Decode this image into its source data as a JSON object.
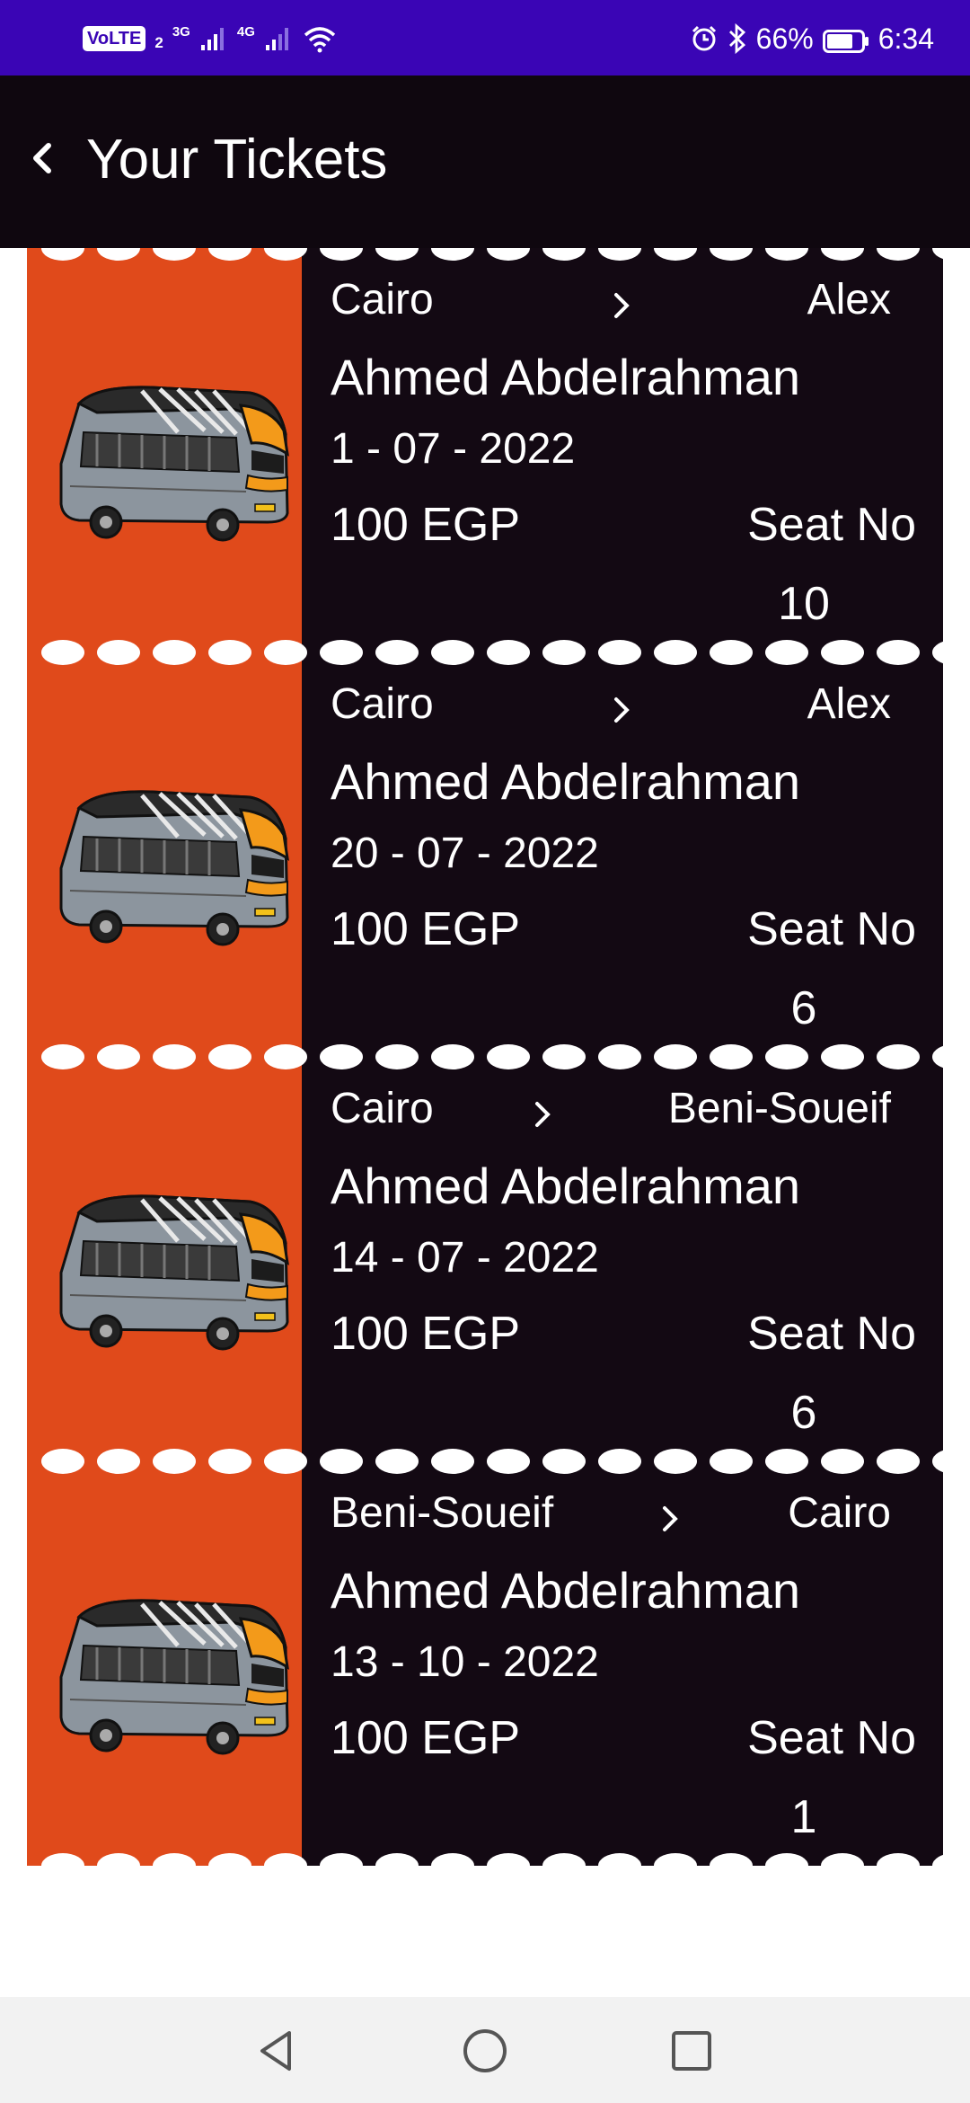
{
  "status_bar": {
    "carrier_badge": "VoLTE",
    "sim_slot": "2",
    "network_1": "3G",
    "network_2": "4G",
    "battery_percent": "66%",
    "time": "6:34"
  },
  "app_bar": {
    "title": "Your Tickets",
    "back_icon": "chevron-left-icon"
  },
  "tickets": [
    {
      "from": "Cairo",
      "to": "Alex",
      "passenger": "Ahmed Abdelrahman",
      "date": "1 - 07 - 2022",
      "price": "100 EGP",
      "seat_label": "Seat No",
      "seat_number": "10"
    },
    {
      "from": "Cairo",
      "to": "Alex",
      "passenger": "Ahmed Abdelrahman",
      "date": "20 - 07 - 2022",
      "price": "100 EGP",
      "seat_label": "Seat No",
      "seat_number": "6"
    },
    {
      "from": "Cairo",
      "to": "Beni-Soueif",
      "passenger": "Ahmed Abdelrahman",
      "date": "14 - 07 - 2022",
      "price": "100 EGP",
      "seat_label": "Seat No",
      "seat_number": "6"
    },
    {
      "from": "Beni-Soueif",
      "to": "Cairo",
      "passenger": "Ahmed Abdelrahman",
      "date": "13 - 10 - 2022",
      "price": "100 EGP",
      "seat_label": "Seat No",
      "seat_number": "1"
    }
  ],
  "colors": {
    "status_bar": "#3a05b5",
    "app_bar": "#0f070f",
    "ticket_body": "#130913",
    "ticket_stub": "#e04a1b",
    "text": "#ffffff"
  },
  "nav_bar": {
    "back_icon": "triangle-back-icon",
    "home_icon": "circle-home-icon",
    "recents_icon": "square-recents-icon"
  }
}
